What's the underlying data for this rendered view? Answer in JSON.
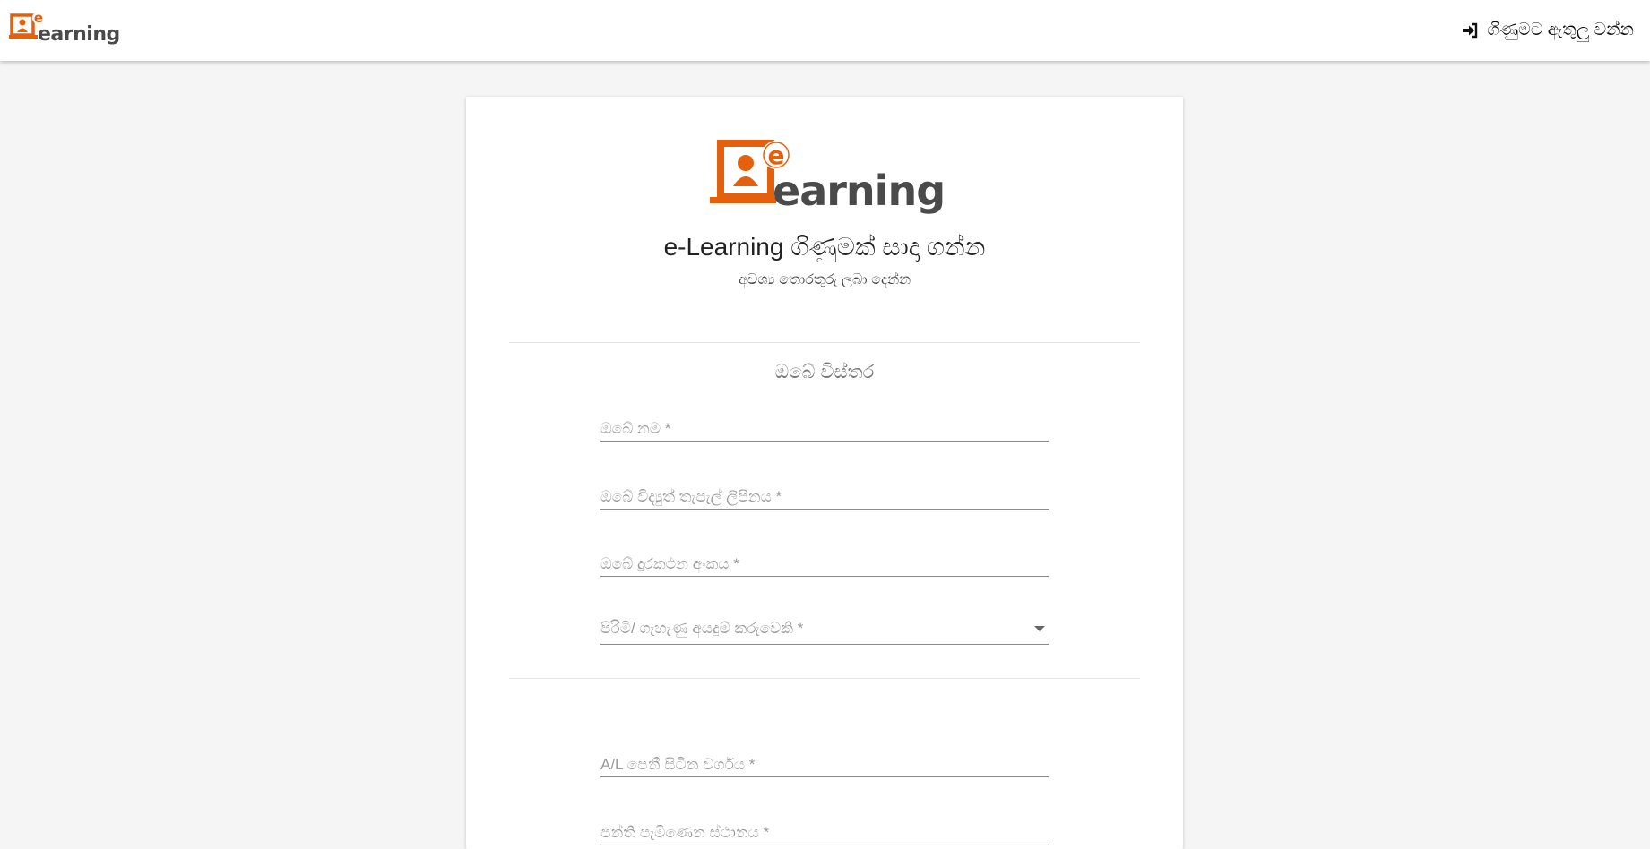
{
  "header": {
    "logo_text": "earning",
    "logo_badge": "e",
    "signin_label": "ගිණුමට ඇතුලු වන්න",
    "signin_icon": "sign-in-icon"
  },
  "card": {
    "logo_text": "earning",
    "logo_badge": "e",
    "title": "e-Learning ගිණුමක් සාදා ගන්න",
    "subtitle": "අවශ්‍ය තොරතුරු ලබා දෙන්න",
    "section_title": "ඔබේ විස්තර",
    "fields": {
      "name": "ඔබේ නම *",
      "email": "ඔබේ විද්‍යුත් තැපැල් ලිපිනය *",
      "phone": "ඔබේ දුරකථන අංකය *",
      "gender": "පිරිමි/ ගැහැණු අයදුම් කරුවෙකි *",
      "al_stream": "A/L පෙනී සිටින වර්ගය *",
      "class_location": "පන්ති පැමිණෙන ස්ථානය *"
    }
  },
  "colors": {
    "brand_orange": "#e5600d",
    "brand_gray": "#4a4a4a",
    "background": "#f5f5f5"
  }
}
